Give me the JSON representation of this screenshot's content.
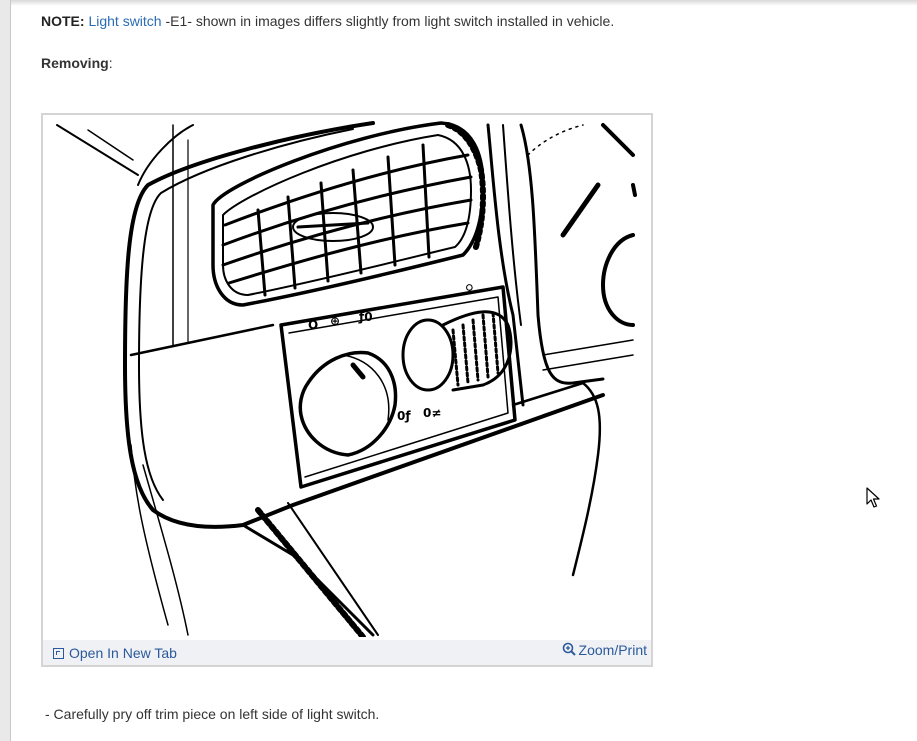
{
  "note": {
    "prefix": "NOTE:",
    "link": "Light switch",
    "suffix": " -E1- shown in images differs slightly from light switch installed in vehicle."
  },
  "section_heading": "Removing",
  "section_heading_colon": ":",
  "figure": {
    "dial_symbols": [
      "O",
      "⊕",
      "ƒ0",
      "0ƒ",
      "0≠",
      "♀"
    ],
    "open_tab_label": "Open In New Tab",
    "zoom_print_label": "Zoom/Print"
  },
  "instruction": "-  Carefully pry off trim piece on left side of light switch.",
  "colors": {
    "link": "#2a6db5",
    "toolbar_link": "#2a5a9c",
    "toolbar_bg": "#f0f1f4",
    "frame_border": "#d4d4d4"
  }
}
